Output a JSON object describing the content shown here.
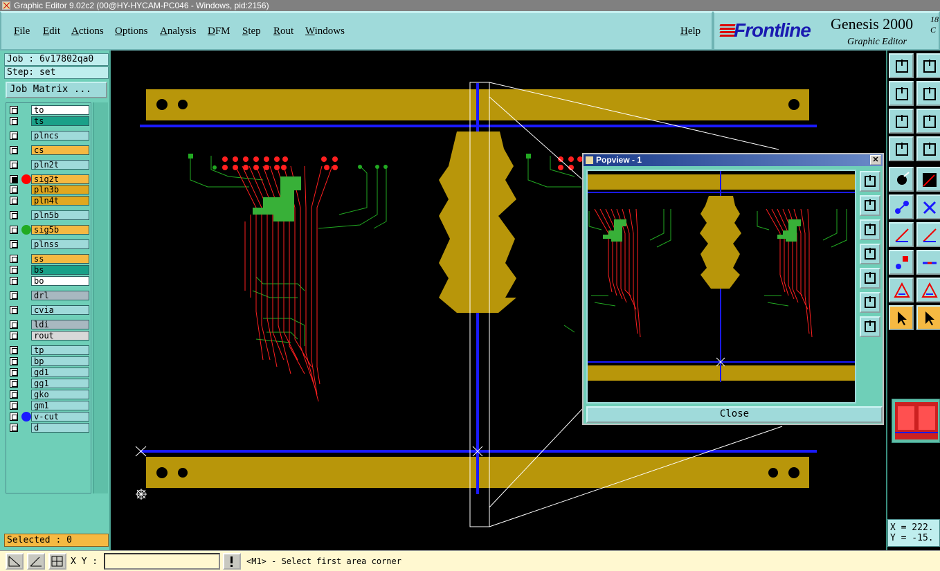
{
  "window": {
    "title": "Graphic Editor 9.02c2 (00@HY-HYCAM-PC046 - Windows, pid:2156)"
  },
  "menu": {
    "items": [
      "File",
      "Edit",
      "Actions",
      "Options",
      "Analysis",
      "DFM",
      "Step",
      "Rout",
      "Windows"
    ],
    "help": "Help"
  },
  "brand": {
    "logo_text": "Frontline",
    "product": "Genesis 2000",
    "version_fragment": "18",
    "version_fragment2": "C",
    "subtitle": "Graphic Editor",
    "colors": {
      "logo_blue": "#1a1ab0",
      "logo_red": "#dd0000"
    }
  },
  "job": {
    "job_label": "Job : 6v17802qa0",
    "step_label": "Step: set",
    "matrix_button": "Job Matrix ..."
  },
  "layers": [
    {
      "name": "to",
      "color": "#ffffff",
      "checked": false,
      "dot": null
    },
    {
      "name": "ts",
      "color": "#1aa088",
      "checked": false,
      "dot": null
    },
    {
      "name": "plncs",
      "color": "#9fdada",
      "checked": false,
      "dot": null
    },
    {
      "name": "cs",
      "color": "#f5b942",
      "checked": false,
      "dot": null
    },
    {
      "name": "pln2t",
      "color": "#9fdada",
      "checked": false,
      "dot": null
    },
    {
      "name": "sig2t",
      "color": "#f5b942",
      "checked": true,
      "dot": "#ff0000"
    },
    {
      "name": "pln3b",
      "color": "#e0a820",
      "checked": false,
      "dot": null
    },
    {
      "name": "pln4t",
      "color": "#e0a820",
      "checked": false,
      "dot": null
    },
    {
      "name": "pln5b",
      "color": "#9fdada",
      "checked": false,
      "dot": null
    },
    {
      "name": "sig5b",
      "color": "#f5b942",
      "checked": false,
      "dot": "#22aa22"
    },
    {
      "name": "plnss",
      "color": "#9fdada",
      "checked": false,
      "dot": null
    },
    {
      "name": "ss",
      "color": "#f5b942",
      "checked": false,
      "dot": null
    },
    {
      "name": "bs",
      "color": "#1aa088",
      "checked": false,
      "dot": null
    },
    {
      "name": "bo",
      "color": "#ffffff",
      "checked": false,
      "dot": null
    },
    {
      "name": "drl",
      "color": "#a8b8c0",
      "checked": false,
      "dot": null
    },
    {
      "name": "cvia",
      "color": "#9fdada",
      "checked": false,
      "dot": null
    },
    {
      "name": "ldi",
      "color": "#a8b8c0",
      "checked": false,
      "dot": null
    },
    {
      "name": "rout",
      "color": "#d8d8d8",
      "checked": false,
      "dot": null
    },
    {
      "name": "tp",
      "color": "#9fdada",
      "checked": false,
      "dot": null
    },
    {
      "name": "bp",
      "color": "#9fdada",
      "checked": false,
      "dot": null
    },
    {
      "name": "gd1",
      "color": "#9fdada",
      "checked": false,
      "dot": null
    },
    {
      "name": "gg1",
      "color": "#9fdada",
      "checked": false,
      "dot": null
    },
    {
      "name": "gko",
      "color": "#9fdada",
      "checked": false,
      "dot": null
    },
    {
      "name": "gm1",
      "color": "#9fdada",
      "checked": false,
      "dot": null
    },
    {
      "name": "v-cut",
      "color": "#9fdada",
      "checked": false,
      "dot": "#1a1aff"
    },
    {
      "name": "d",
      "color": "#9fdada",
      "checked": false,
      "dot": null
    }
  ],
  "status": {
    "selected": "Selected : 0",
    "coord_x": "X = 222.",
    "coord_y": "Y = -15."
  },
  "popview": {
    "title": "Popview - 1",
    "close_x": "✕",
    "close_button": "Close"
  },
  "bottom": {
    "xy_label": "X Y :",
    "xy_value": "",
    "prompt": "<M1> - Select first area corner"
  },
  "colors": {
    "board_gold": "#b8960a",
    "vcut_blue": "#1a1aff",
    "trace_red": "#ff2020",
    "trace_green": "#22aa22",
    "panel_teal": "#6fcfb8"
  }
}
